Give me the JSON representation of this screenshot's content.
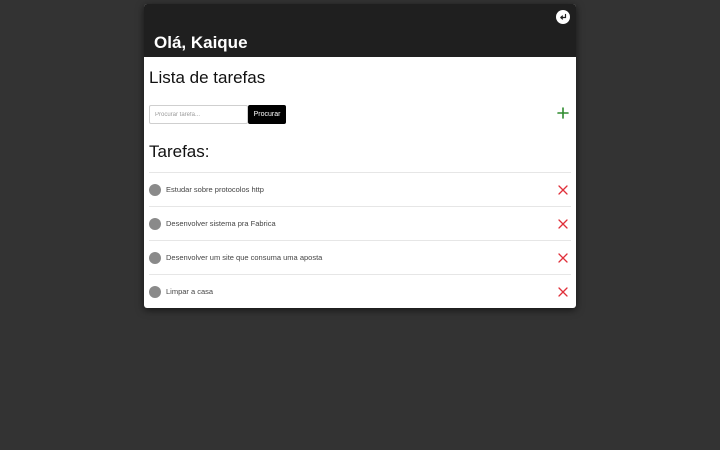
{
  "header": {
    "greeting": "Olá, Kaique",
    "logout_icon": "logout-arrow-icon"
  },
  "main": {
    "title": "Lista de tarefas",
    "search": {
      "placeholder": "Procurar tarefa...",
      "value": "",
      "button_label": "Procurar"
    },
    "add_icon": "plus-icon",
    "tasks_heading": "Tarefas:"
  },
  "tasks": [
    {
      "label": "Estudar sobre protocolos http"
    },
    {
      "label": "Desenvolver sistema pra Fabrica"
    },
    {
      "label": "Desenvolver um site que consuma uma aposta"
    },
    {
      "label": "Limpar a casa"
    }
  ],
  "colors": {
    "background": "#333333",
    "header": "#1f1f1f",
    "add": "#2e8b2e",
    "delete": "#e0303a",
    "check": "#8a8a8a"
  }
}
